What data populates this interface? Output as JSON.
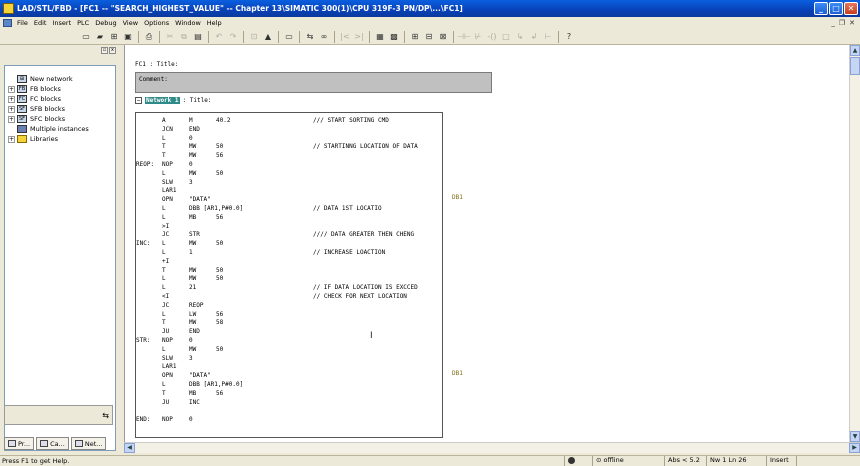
{
  "window": {
    "title": "LAD/STL/FBD  - [FC1 -- \"SEARCH_HIGHEST_VALUE\" -- Chapter 13\\SIMATIC 300(1)\\CPU 319F-3 PN/DP\\...\\FC1]"
  },
  "menu": [
    "File",
    "Edit",
    "Insert",
    "PLC",
    "Debug",
    "View",
    "Options",
    "Window",
    "Help"
  ],
  "sidebar": {
    "items": [
      {
        "label": "New network",
        "expandable": false,
        "icon": "new-network-icon"
      },
      {
        "label": "FB blocks",
        "expandable": true,
        "icon": "block-folder-icon"
      },
      {
        "label": "FC blocks",
        "expandable": true,
        "icon": "block-folder-icon"
      },
      {
        "label": "SFB blocks",
        "expandable": true,
        "icon": "block-folder-icon"
      },
      {
        "label": "SFC blocks",
        "expandable": true,
        "icon": "block-folder-icon"
      },
      {
        "label": "Multiple instances",
        "expandable": false,
        "icon": "multiple-instances-icon"
      },
      {
        "label": "Libraries",
        "expandable": true,
        "icon": "libraries-icon"
      }
    ],
    "tabs": [
      "Pr...",
      "Ca...",
      "Net..."
    ]
  },
  "editor": {
    "block_title": "FC1 : Title:",
    "comment_label": "Comment:",
    "network_label": "Network 1",
    "network_title": ": Title:",
    "code": [
      {
        "label": "",
        "op": "A",
        "a1": "M",
        "a2": "40.2",
        "cmt": "/// START SORTING CMD"
      },
      {
        "label": "",
        "op": "JCN",
        "a1": "END",
        "a2": "",
        "cmt": ""
      },
      {
        "label": "",
        "op": "L",
        "a1": "0",
        "a2": "",
        "cmt": ""
      },
      {
        "label": "",
        "op": "T",
        "a1": "MW",
        "a2": "50",
        "cmt": "// STARTINNG LOCATION OF DATA"
      },
      {
        "label": "",
        "op": "T",
        "a1": "MW",
        "a2": "56",
        "cmt": ""
      },
      {
        "label": "REOP:",
        "op": "NOP",
        "a1": "0",
        "a2": "",
        "cmt": ""
      },
      {
        "label": "",
        "op": "L",
        "a1": "MW",
        "a2": "50",
        "cmt": ""
      },
      {
        "label": "",
        "op": "SLW",
        "a1": "3",
        "a2": "",
        "cmt": ""
      },
      {
        "label": "",
        "op": "LAR1",
        "a1": "",
        "a2": "",
        "cmt": ""
      },
      {
        "label": "",
        "op": "OPN",
        "a1": "\"DATA\"",
        "a2": "",
        "cmt": ""
      },
      {
        "label": "",
        "op": "L",
        "a1": "DBB [AR1,P#0.0]",
        "a2": "",
        "cmt": "// DATA 1ST LOCATIO"
      },
      {
        "label": "",
        "op": "L",
        "a1": "MB",
        "a2": "56",
        "cmt": ""
      },
      {
        "label": "",
        "op": ">I",
        "a1": "",
        "a2": "",
        "cmt": ""
      },
      {
        "label": "",
        "op": "JC",
        "a1": "STR",
        "a2": "",
        "cmt": "//// DATA GREATER THEN CHENG"
      },
      {
        "label": "INC:",
        "op": "L",
        "a1": "MW",
        "a2": "50",
        "cmt": ""
      },
      {
        "label": "",
        "op": "L",
        "a1": "1",
        "a2": "",
        "cmt": "// INCREASE LOACTION"
      },
      {
        "label": "",
        "op": "+I",
        "a1": "",
        "a2": "",
        "cmt": ""
      },
      {
        "label": "",
        "op": "T",
        "a1": "MW",
        "a2": "50",
        "cmt": ""
      },
      {
        "label": "",
        "op": "L",
        "a1": "MW",
        "a2": "50",
        "cmt": ""
      },
      {
        "label": "",
        "op": "L",
        "a1": "21",
        "a2": "",
        "cmt": "// IF DATA LOCATION IS EXCCED"
      },
      {
        "label": "",
        "op": "<I",
        "a1": "",
        "a2": "",
        "cmt": "// CHECK FOR NEXT LOCATION"
      },
      {
        "label": "",
        "op": "JC",
        "a1": "REOP",
        "a2": "",
        "cmt": ""
      },
      {
        "label": "",
        "op": "L",
        "a1": "LW",
        "a2": "56",
        "cmt": ""
      },
      {
        "label": "",
        "op": "T",
        "a1": "MW",
        "a2": "58",
        "cmt": ""
      },
      {
        "label": "",
        "op": "JU",
        "a1": "END",
        "a2": "",
        "cmt": ""
      },
      {
        "label": "STR:",
        "op": "NOP",
        "a1": "0",
        "a2": "",
        "cmt": ""
      },
      {
        "label": "",
        "op": "L",
        "a1": "MW",
        "a2": "50",
        "cmt": ""
      },
      {
        "label": "",
        "op": "SLW",
        "a1": "3",
        "a2": "",
        "cmt": ""
      },
      {
        "label": "",
        "op": "LAR1",
        "a1": "",
        "a2": "",
        "cmt": ""
      },
      {
        "label": "",
        "op": "OPN",
        "a1": "\"DATA\"",
        "a2": "",
        "cmt": ""
      },
      {
        "label": "",
        "op": "L",
        "a1": "DBB [AR1,P#0.0]",
        "a2": "",
        "cmt": ""
      },
      {
        "label": "",
        "op": "T",
        "a1": "MB",
        "a2": "56",
        "cmt": ""
      },
      {
        "label": "",
        "op": "JU",
        "a1": "INC",
        "a2": "",
        "cmt": ""
      },
      {
        "label": "",
        "op": "",
        "a1": "",
        "a2": "",
        "cmt": ""
      },
      {
        "label": "END:",
        "op": "NOP",
        "a1": "0",
        "a2": "",
        "cmt": ""
      }
    ],
    "db_marks": [
      {
        "row": 9,
        "text": "DB1"
      },
      {
        "row": 29,
        "text": "DB1"
      }
    ]
  },
  "status": {
    "help": "Press F1 to get Help.",
    "mode": "offline",
    "abs": "Abs < 5.2",
    "position": "Nw 1 Ln 26",
    "insert": "Insert"
  }
}
